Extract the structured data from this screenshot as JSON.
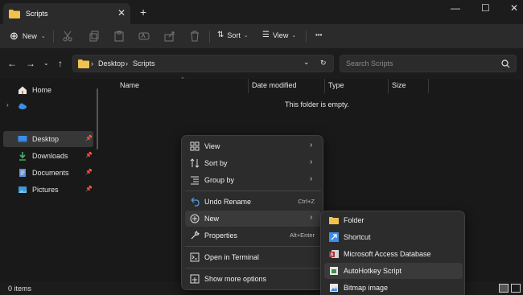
{
  "window": {
    "tab_title": "Scripts",
    "tab_close": "✕",
    "new_tab": "+",
    "minimize": "—",
    "maximize": "☐",
    "close": "✕"
  },
  "toolbar": {
    "new_label": "New",
    "sort_label": "Sort",
    "view_label": "View",
    "more": "•••",
    "icons": [
      "cut-icon",
      "copy-icon",
      "paste-icon",
      "rename-icon",
      "share-icon",
      "delete-icon"
    ]
  },
  "address": {
    "back": "←",
    "forward": "→",
    "up": "↑",
    "crumbs": [
      "Desktop",
      "Scripts"
    ],
    "crumb_sep": "›",
    "dropdown": "⌄",
    "refresh": "↻",
    "search_placeholder": "Search Scripts"
  },
  "sidebar": {
    "items": [
      {
        "label": "Home",
        "icon": "home-icon",
        "pinned": false
      },
      {
        "label": "",
        "icon": "onedrive-icon",
        "pinned": false
      },
      {
        "label": "Desktop",
        "icon": "desktop-icon",
        "pinned": true,
        "selected": true
      },
      {
        "label": "Downloads",
        "icon": "downloads-icon",
        "pinned": true
      },
      {
        "label": "Documents",
        "icon": "documents-icon",
        "pinned": true
      },
      {
        "label": "Pictures",
        "icon": "pictures-icon",
        "pinned": true
      }
    ]
  },
  "columns": [
    "Name",
    "Date modified",
    "Type",
    "Size"
  ],
  "empty_message": "This folder is empty.",
  "status": {
    "items": "0 items"
  },
  "context_menu": {
    "items": [
      {
        "label": "View",
        "icon": "view-icon",
        "submenu": true
      },
      {
        "label": "Sort by",
        "icon": "sort-icon",
        "submenu": true
      },
      {
        "label": "Group by",
        "icon": "group-icon",
        "submenu": true
      },
      {
        "label": "Undo Rename",
        "icon": "undo-icon",
        "shortcut": "Ctrl+Z"
      },
      {
        "label": "New",
        "icon": "new-icon",
        "submenu": true,
        "highlighted": true
      },
      {
        "label": "Properties",
        "icon": "properties-icon",
        "shortcut": "Alt+Enter"
      },
      {
        "label": "Open in Terminal",
        "icon": "terminal-icon"
      },
      {
        "label": "Show more options",
        "icon": "more-options-icon"
      }
    ]
  },
  "submenu": {
    "items": [
      {
        "label": "Folder",
        "icon": "folder-icon"
      },
      {
        "label": "Shortcut",
        "icon": "shortcut-icon"
      },
      {
        "label": "Microsoft Access Database",
        "icon": "access-icon"
      },
      {
        "label": "AutoHotkey Script",
        "icon": "autohotkey-icon",
        "highlighted": true
      },
      {
        "label": "Bitmap image",
        "icon": "bitmap-icon"
      }
    ]
  },
  "colors": {
    "folder": "#f2c14e",
    "accent_blue": "#3b8eea",
    "selected_bg": "#373737"
  }
}
